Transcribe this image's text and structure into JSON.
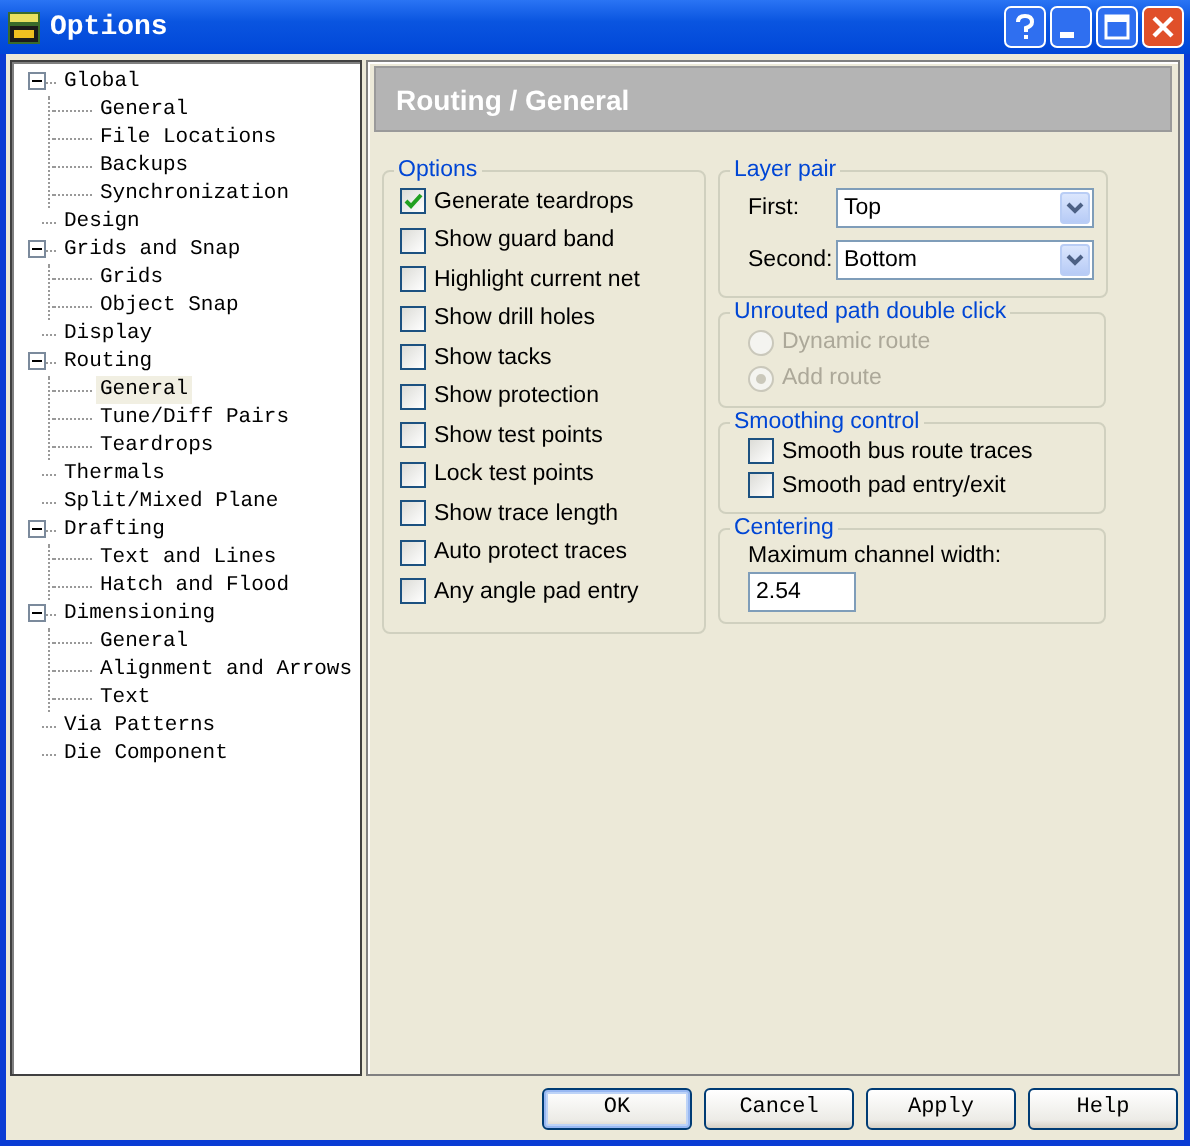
{
  "window": {
    "title": "Options"
  },
  "tree": [
    {
      "label": "Global",
      "selected": false,
      "expanded": true,
      "children": [
        {
          "label": "General",
          "selected": false
        },
        {
          "label": "File Locations",
          "selected": false
        },
        {
          "label": "Backups",
          "selected": false
        },
        {
          "label": "Synchronization",
          "selected": false
        }
      ]
    },
    {
      "label": "Design",
      "selected": false
    },
    {
      "label": "Grids and Snap",
      "selected": false,
      "expanded": true,
      "children": [
        {
          "label": "Grids",
          "selected": false
        },
        {
          "label": "Object Snap",
          "selected": false
        }
      ]
    },
    {
      "label": "Display",
      "selected": false
    },
    {
      "label": "Routing",
      "selected": false,
      "expanded": true,
      "children": [
        {
          "label": "General",
          "selected": true
        },
        {
          "label": "Tune/Diff Pairs",
          "selected": false
        },
        {
          "label": "Teardrops",
          "selected": false
        }
      ]
    },
    {
      "label": "Thermals",
      "selected": false
    },
    {
      "label": "Split/Mixed Plane",
      "selected": false
    },
    {
      "label": "Drafting",
      "selected": false,
      "expanded": true,
      "children": [
        {
          "label": "Text and Lines",
          "selected": false
        },
        {
          "label": "Hatch and Flood",
          "selected": false
        }
      ]
    },
    {
      "label": "Dimensioning",
      "selected": false,
      "expanded": true,
      "children": [
        {
          "label": "General",
          "selected": false
        },
        {
          "label": "Alignment and Arrows",
          "selected": false
        },
        {
          "label": "Text",
          "selected": false
        }
      ]
    },
    {
      "label": "Via Patterns",
      "selected": false
    },
    {
      "label": "Die Component",
      "selected": false
    }
  ],
  "page_header": "Routing / General",
  "options": {
    "title": "Options",
    "items": [
      {
        "label": "Generate teardrops",
        "checked": true
      },
      {
        "label": "Show guard band",
        "checked": false
      },
      {
        "label": "Highlight current net",
        "checked": false
      },
      {
        "label": "Show drill holes",
        "checked": false
      },
      {
        "label": "Show tacks",
        "checked": false
      },
      {
        "label": "Show protection",
        "checked": false
      },
      {
        "label": "Show test points",
        "checked": false
      },
      {
        "label": "Lock test points",
        "checked": false
      },
      {
        "label": "Show trace length",
        "checked": false
      },
      {
        "label": "Auto protect traces",
        "checked": false
      },
      {
        "label": "Any angle pad entry",
        "checked": false
      }
    ]
  },
  "layer_pair": {
    "title": "Layer pair",
    "fields": [
      {
        "label": "First:",
        "value": "Top"
      },
      {
        "label": "Second:",
        "value": "Bottom"
      }
    ]
  },
  "unrouted": {
    "title": "Unrouted path double click",
    "disabled": true,
    "choices": [
      {
        "label": "Dynamic route",
        "selected": false
      },
      {
        "label": "Add route",
        "selected": true
      }
    ]
  },
  "smoothing": {
    "title": "Smoothing control",
    "items": [
      {
        "label": "Smooth bus route traces",
        "checked": false
      },
      {
        "label": "Smooth pad entry/exit",
        "checked": false
      }
    ]
  },
  "centering": {
    "title": "Centering",
    "label": "Maximum channel width:",
    "value": "2.54"
  },
  "buttons": [
    {
      "label": "OK",
      "default": true
    },
    {
      "label": "Cancel",
      "default": false
    },
    {
      "label": "Apply",
      "default": false
    },
    {
      "label": "Help",
      "default": false
    }
  ]
}
